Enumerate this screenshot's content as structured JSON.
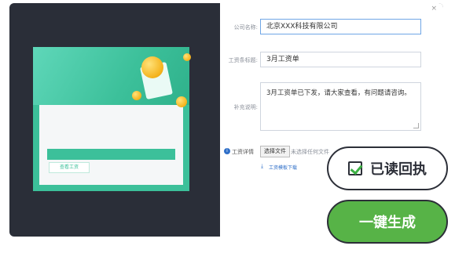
{
  "preview": {
    "tab_label": "查看工资"
  },
  "form": {
    "close_label": "×",
    "company_label": "公司名称:",
    "company_value": "北京XXX科技有限公司",
    "title_label": "工资条标题:",
    "title_value": "3月工资单",
    "note_label": "补充说明:",
    "note_value": "3月工资单已下发，请大家查看，有问题请咨询。",
    "file_label": "工资详情",
    "file_button": "选择文件",
    "file_hint": "未选择任何文件",
    "template_link": "工资模板下载"
  },
  "actions": {
    "receipt_label": "已读回执",
    "generate_label": "一键生成"
  },
  "colors": {
    "accent_green": "#57b347",
    "preview_green": "#3cc09a",
    "dark_bg": "#2a2e38",
    "link_blue": "#2f6fc8"
  }
}
